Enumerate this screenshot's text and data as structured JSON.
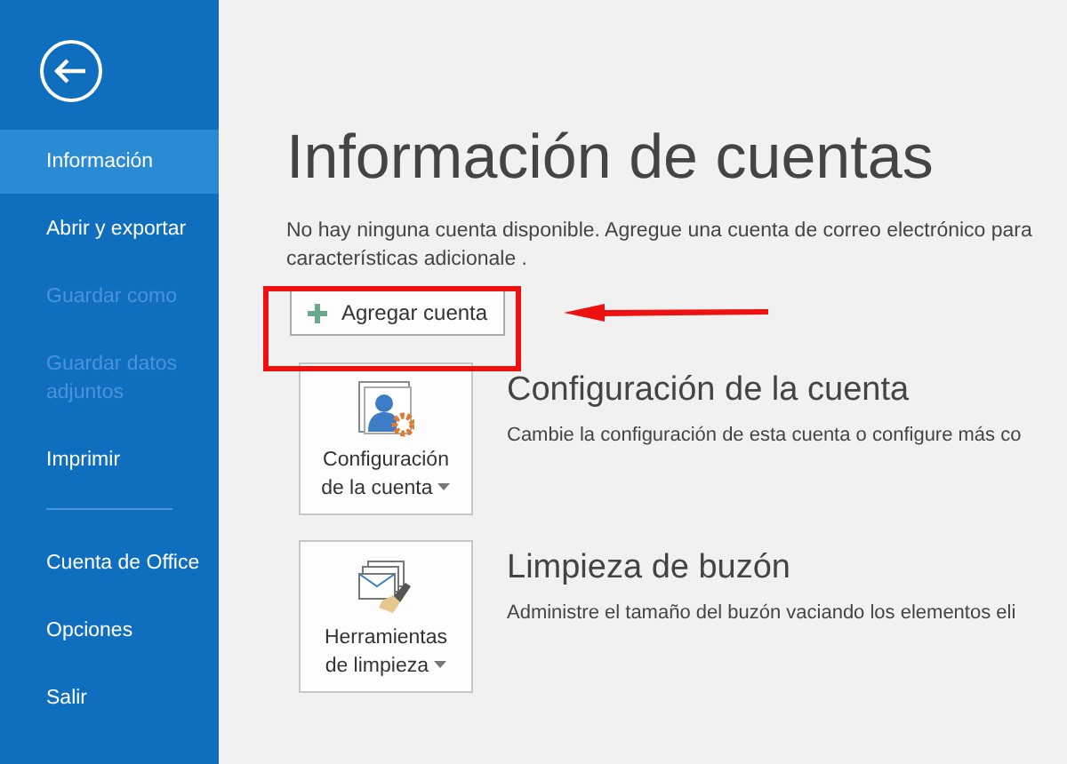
{
  "sidebar": {
    "back": true,
    "items": [
      {
        "label": "Información",
        "selected": true,
        "disabled": false
      },
      {
        "label": "Abrir y exportar",
        "selected": false,
        "disabled": false
      },
      {
        "label": "Guardar como",
        "selected": false,
        "disabled": true
      },
      {
        "label": "Guardar datos adjuntos",
        "selected": false,
        "disabled": true
      },
      {
        "label": "Imprimir",
        "selected": false,
        "disabled": false
      },
      {
        "kind": "divider"
      },
      {
        "label": "Cuenta de Office",
        "selected": false,
        "disabled": false
      },
      {
        "label": "Opciones",
        "selected": false,
        "disabled": false
      },
      {
        "label": "Salir",
        "selected": false,
        "disabled": false
      }
    ]
  },
  "main": {
    "title": "Información de cuentas",
    "intro_lines": [
      "No hay ninguna cuenta disponible. Agregue una cuenta de correo electrónico para",
      "características adicionale ."
    ],
    "add_button": "Agregar cuenta",
    "sections": [
      {
        "kind": "settings",
        "tile": "Configuración de la cuenta",
        "heading": "Configuración de la cuenta",
        "text": "Cambie la configuración de esta cuenta o configure más co"
      },
      {
        "kind": "cleanup",
        "tile": "Herramientas de limpieza",
        "heading": "Limpieza de buzón",
        "text": "Administre el tamaño del buzón vaciando los elementos eli"
      }
    ]
  },
  "annotation": {
    "box": true,
    "arrow": true
  }
}
